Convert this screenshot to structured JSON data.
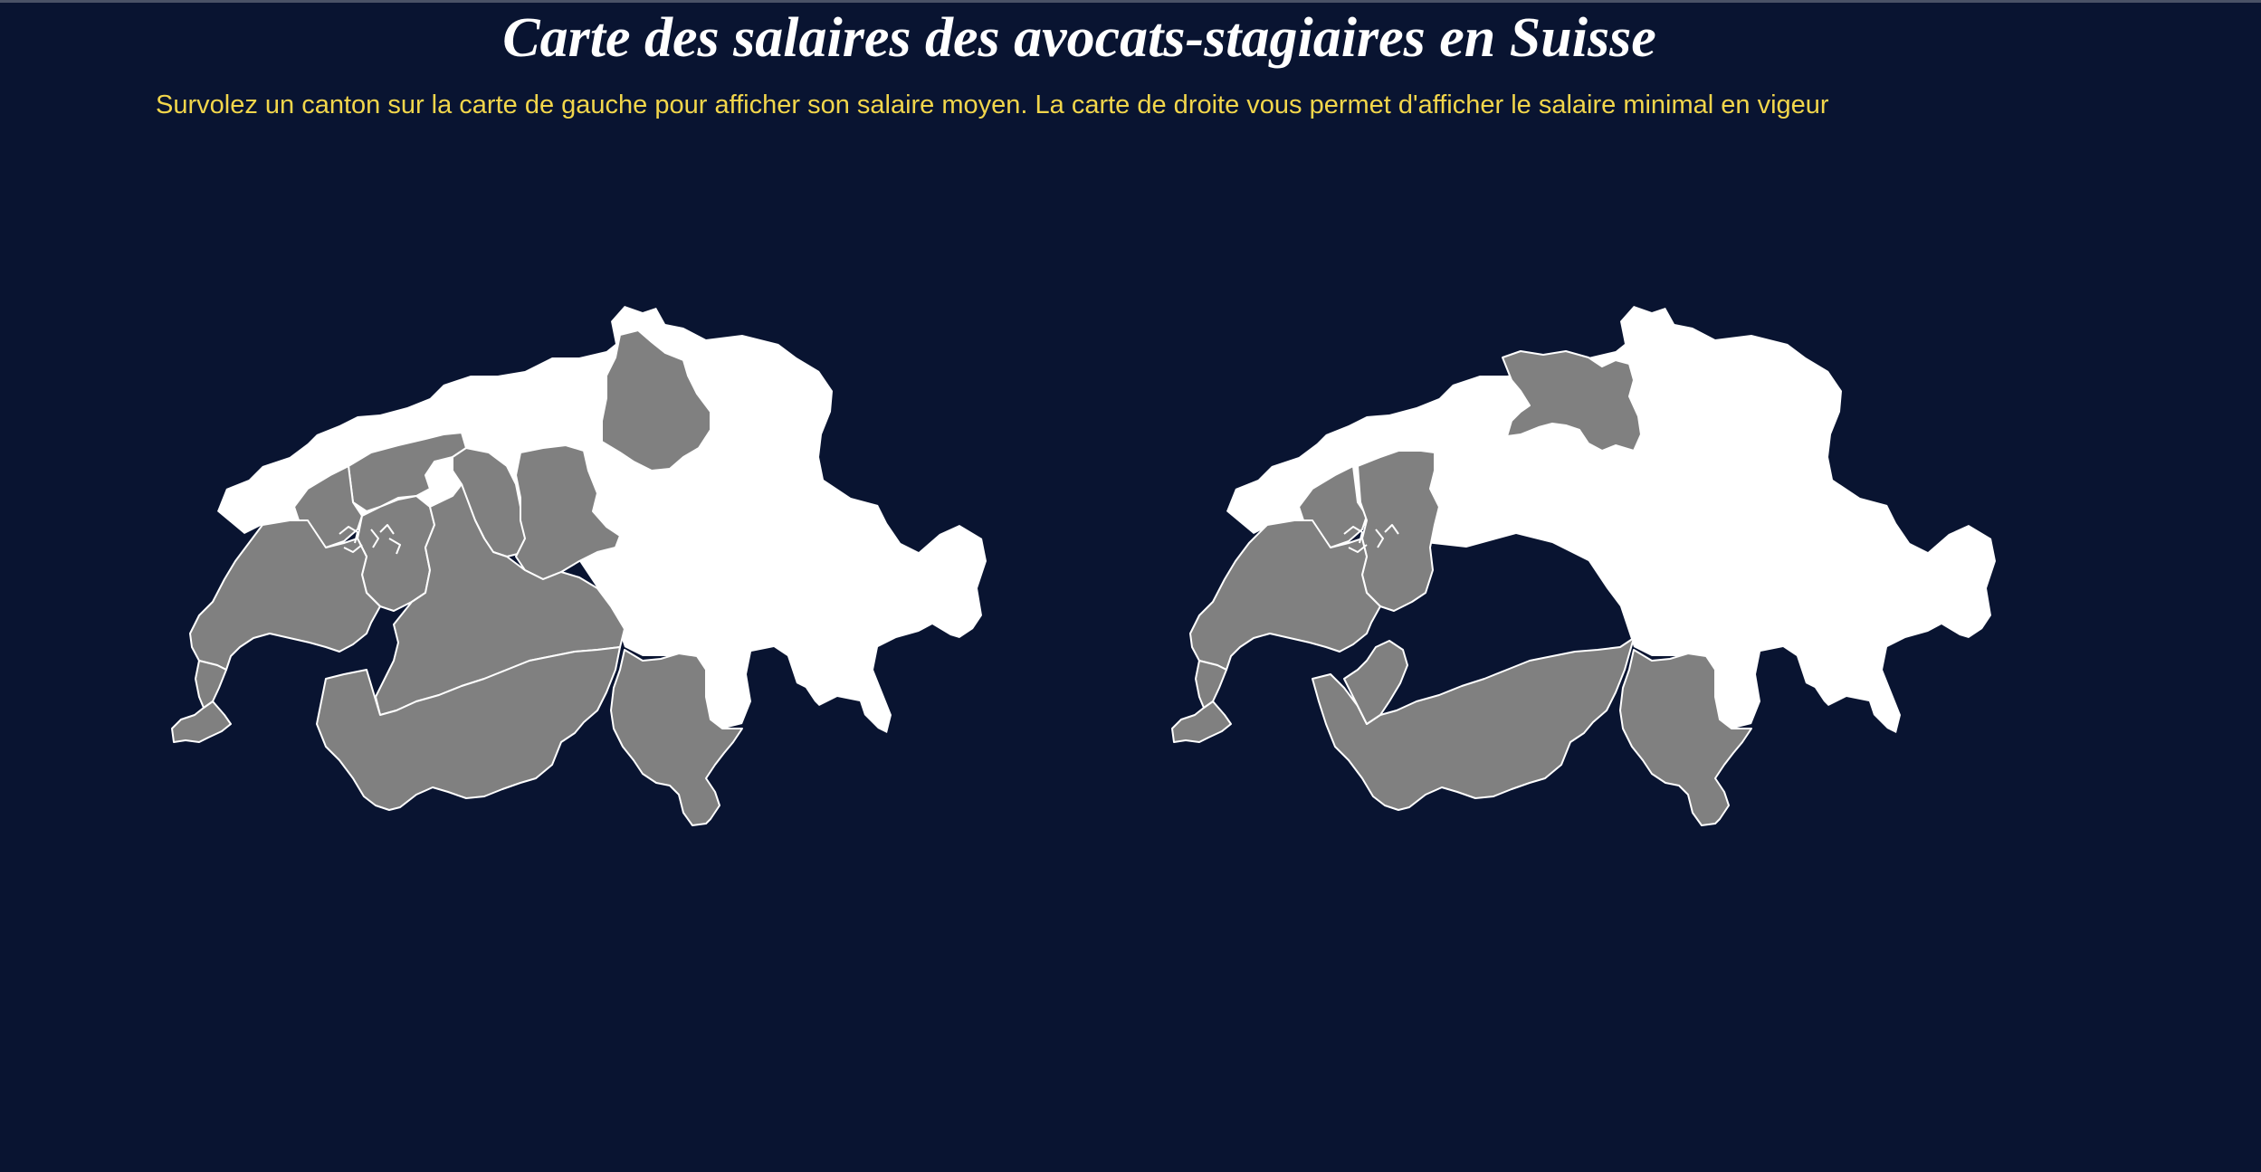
{
  "page": {
    "title": "Carte des salaires des avocats-stagiaires en Suisse",
    "subtitle": "Survolez un canton sur la carte de gauche pour afficher son salaire moyen. La carte de droite vous permet d'afficher le salaire minimal en vigeur"
  },
  "colors": {
    "background": "#091431",
    "title": "#ffffff",
    "subtitle": "#f2d64b",
    "canton_highlight": "#808080",
    "canton_default": "#ffffff"
  },
  "maps": [
    {
      "id": "salaire-moyen",
      "highlighted_cantons": [
        "Genève",
        "Vaud",
        "Fribourg",
        "Neuchâtel",
        "Berne",
        "Jura",
        "Soleure",
        "Lucerne",
        "Valais",
        "Tessin",
        "Zurich"
      ]
    },
    {
      "id": "salaire-minimal",
      "highlighted_cantons": [
        "Genève",
        "Vaud",
        "Fribourg",
        "Neuchâtel",
        "Valais",
        "Tessin",
        "Argovie"
      ]
    }
  ]
}
